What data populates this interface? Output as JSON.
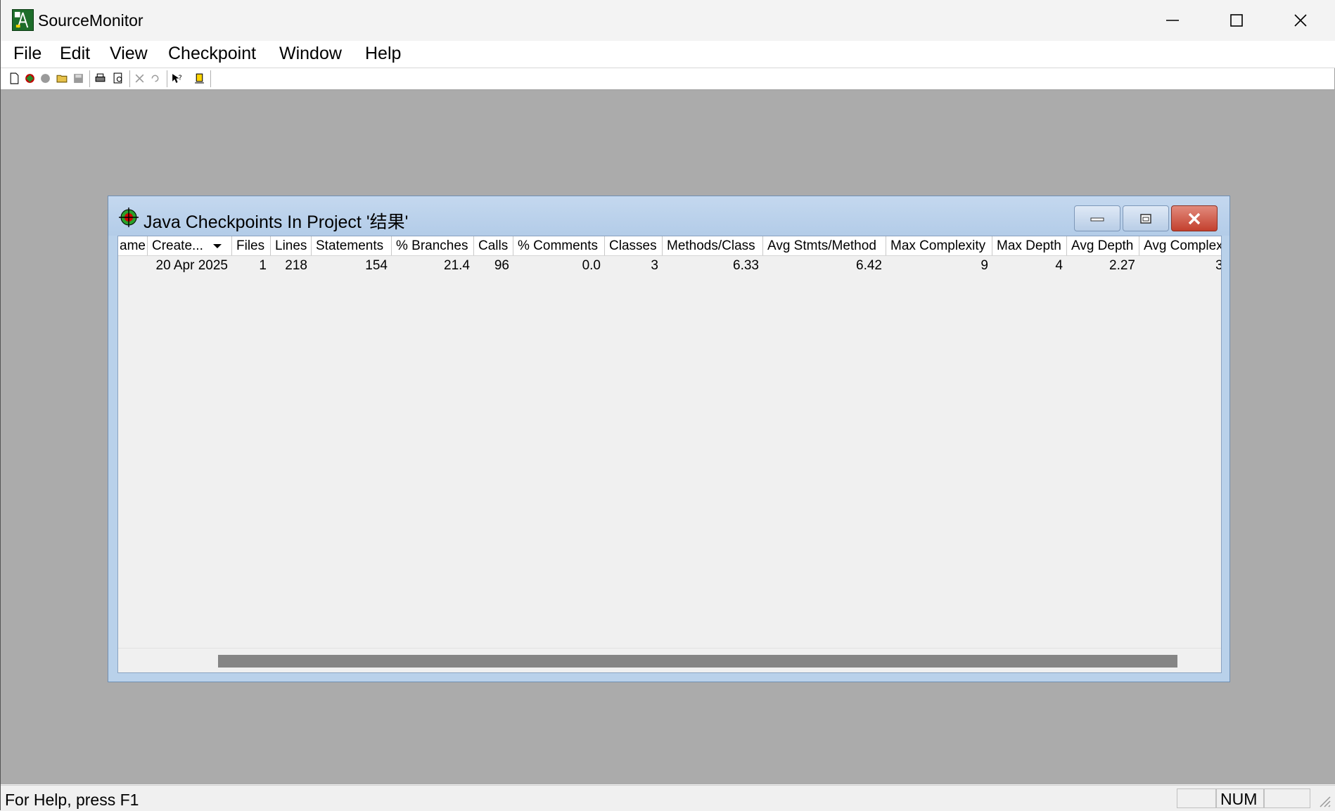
{
  "app": {
    "title": "SourceMonitor",
    "icon": "sourcemonitor-app-icon"
  },
  "window_controls": {
    "minimize_icon": "minimize-icon",
    "maximize_icon": "maximize-icon",
    "close_icon": "close-icon"
  },
  "menu": {
    "items": [
      "File",
      "Edit",
      "View",
      "Checkpoint",
      "Window",
      "Help"
    ]
  },
  "toolbar": {
    "buttons": [
      "new-document-icon",
      "new-project-icon",
      "copy-checkpoint-icon",
      "open-folder-icon",
      "save-icon",
      "print-icon",
      "print-preview-icon",
      "delete-icon",
      "undo-icon",
      "context-help-icon",
      "bookmark-icon"
    ]
  },
  "child_window": {
    "title": "Java Checkpoints In Project '结果'",
    "icon": "target-icon",
    "columns": [
      "ame",
      "Create...",
      "Files",
      "Lines",
      "Statements",
      "% Branches",
      "Calls",
      "% Comments",
      "Classes",
      "Methods/Class",
      "Avg Stmts/Method",
      "Max Complexity",
      "Max Depth",
      "Avg Depth",
      "Avg Complex"
    ],
    "sorted_column": "Create...",
    "rows": [
      {
        "name": "",
        "created": "20 Apr 2025",
        "files": "1",
        "lines": "218",
        "statements": "154",
        "branches": "21.4",
        "calls": "96",
        "comments": "0.0",
        "classes": "3",
        "methods_per_class": "6.33",
        "avg_stmts_per_method": "6.42",
        "max_complexity": "9",
        "max_depth": "4",
        "avg_depth": "2.27",
        "avg_complexity": "3."
      }
    ]
  },
  "status": {
    "help_text": "For Help, press F1",
    "num_indicator": "NUM"
  },
  "colors": {
    "mdi_background": "#ababab",
    "child_frame": "#b9d1ea",
    "close_button": "#c3402e"
  }
}
